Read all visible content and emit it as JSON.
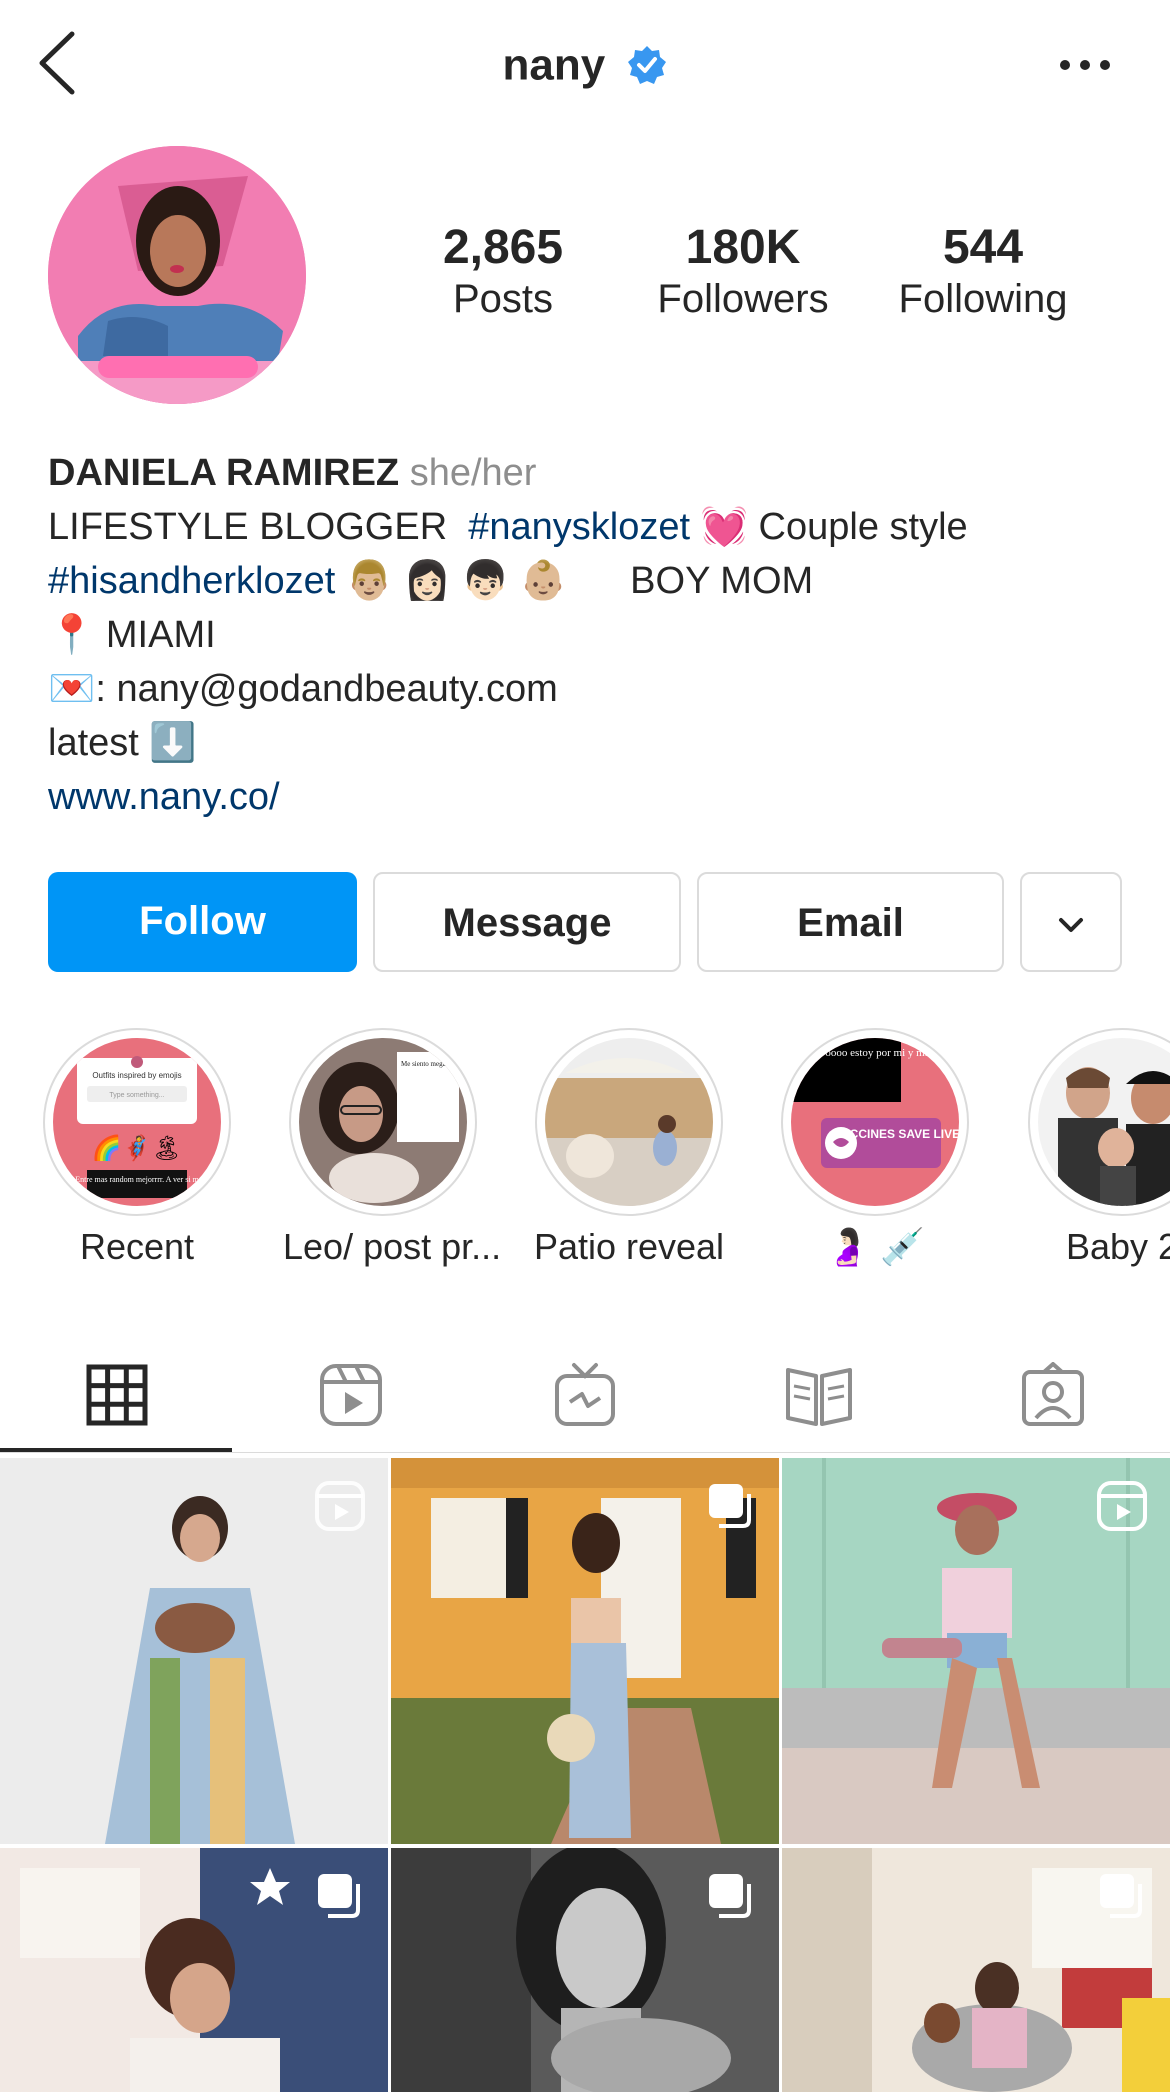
{
  "header": {
    "username": "nany",
    "icons": {
      "back": "chevron-left-icon",
      "verified": "verified-badge-icon",
      "more": "more-horizontal-icon"
    },
    "verified_color": "#3897f0"
  },
  "profile": {
    "avatar": "profile-avatar",
    "stats": [
      {
        "value": "2,865",
        "label": "Posts"
      },
      {
        "value": "180K",
        "label": "Followers"
      },
      {
        "value": "544",
        "label": "Following"
      }
    ]
  },
  "bio": {
    "name": "DANIELA RAMIREZ",
    "pronouns": "she/her",
    "line1_text": "LIFESTYLE BLOGGER",
    "line1_tag": "#nanysklozet",
    "line1_emoji": "💓",
    "line1_tail": "Couple style",
    "line2_tag": "#hisandherklozet",
    "line2_emojis": "👨🏼 👩🏻 👦🏻 👶🏼",
    "line2_tail": "BOY MOM",
    "line3_emoji": "📍",
    "line3_text": "MIAMI",
    "line4_emoji": "💌",
    "line4_text": ": nany@godandbeauty.com",
    "line5_text": "latest",
    "line5_emoji": "⬇️",
    "website": "www.nany.co/"
  },
  "actions": {
    "follow": "Follow",
    "message": "Message",
    "email": "Email",
    "more_icon": "chevron-down-icon"
  },
  "colors": {
    "accent": "#0095f6",
    "link": "#00376b",
    "text": "#262626",
    "muted": "#8e8e8e",
    "border": "#dbdbdb"
  },
  "highlights": [
    {
      "label": "Recent"
    },
    {
      "label": "Leo/ post pr..."
    },
    {
      "label": "Patio reveal"
    },
    {
      "label": "🤰🏻 💉"
    },
    {
      "label": "Baby 2"
    }
  ],
  "highlight_texts": {
    "recent_top": "Outfits inspired by emojis",
    "recent_input": "Type something...",
    "recent_bottom": "Entre mas random mejorrrr. A ver si m",
    "leo_note": "Me siento mega bien GAD, voy a intentar hacer el LIVE mañana el mediodía como story time!",
    "preg_top": "malas oooo estoy por mi y mi bebé !",
    "preg_badge": "VACCINES SAVE LIVES"
  },
  "tabs": [
    {
      "name": "grid-icon",
      "active": true
    },
    {
      "name": "reels-icon",
      "active": false
    },
    {
      "name": "igtv-icon",
      "active": false
    },
    {
      "name": "guides-icon",
      "active": false
    },
    {
      "name": "tagged-icon",
      "active": false
    }
  ],
  "posts": [
    {
      "type": "reel",
      "badge": "reels-badge-icon"
    },
    {
      "type": "carousel",
      "badge": "carousel-badge-icon"
    },
    {
      "type": "reel",
      "badge": "reels-badge-icon"
    },
    {
      "type": "carousel",
      "badge": "carousel-badge-icon"
    },
    {
      "type": "carousel",
      "badge": "carousel-badge-icon"
    },
    {
      "type": "carousel",
      "badge": "carousel-badge-icon"
    }
  ]
}
